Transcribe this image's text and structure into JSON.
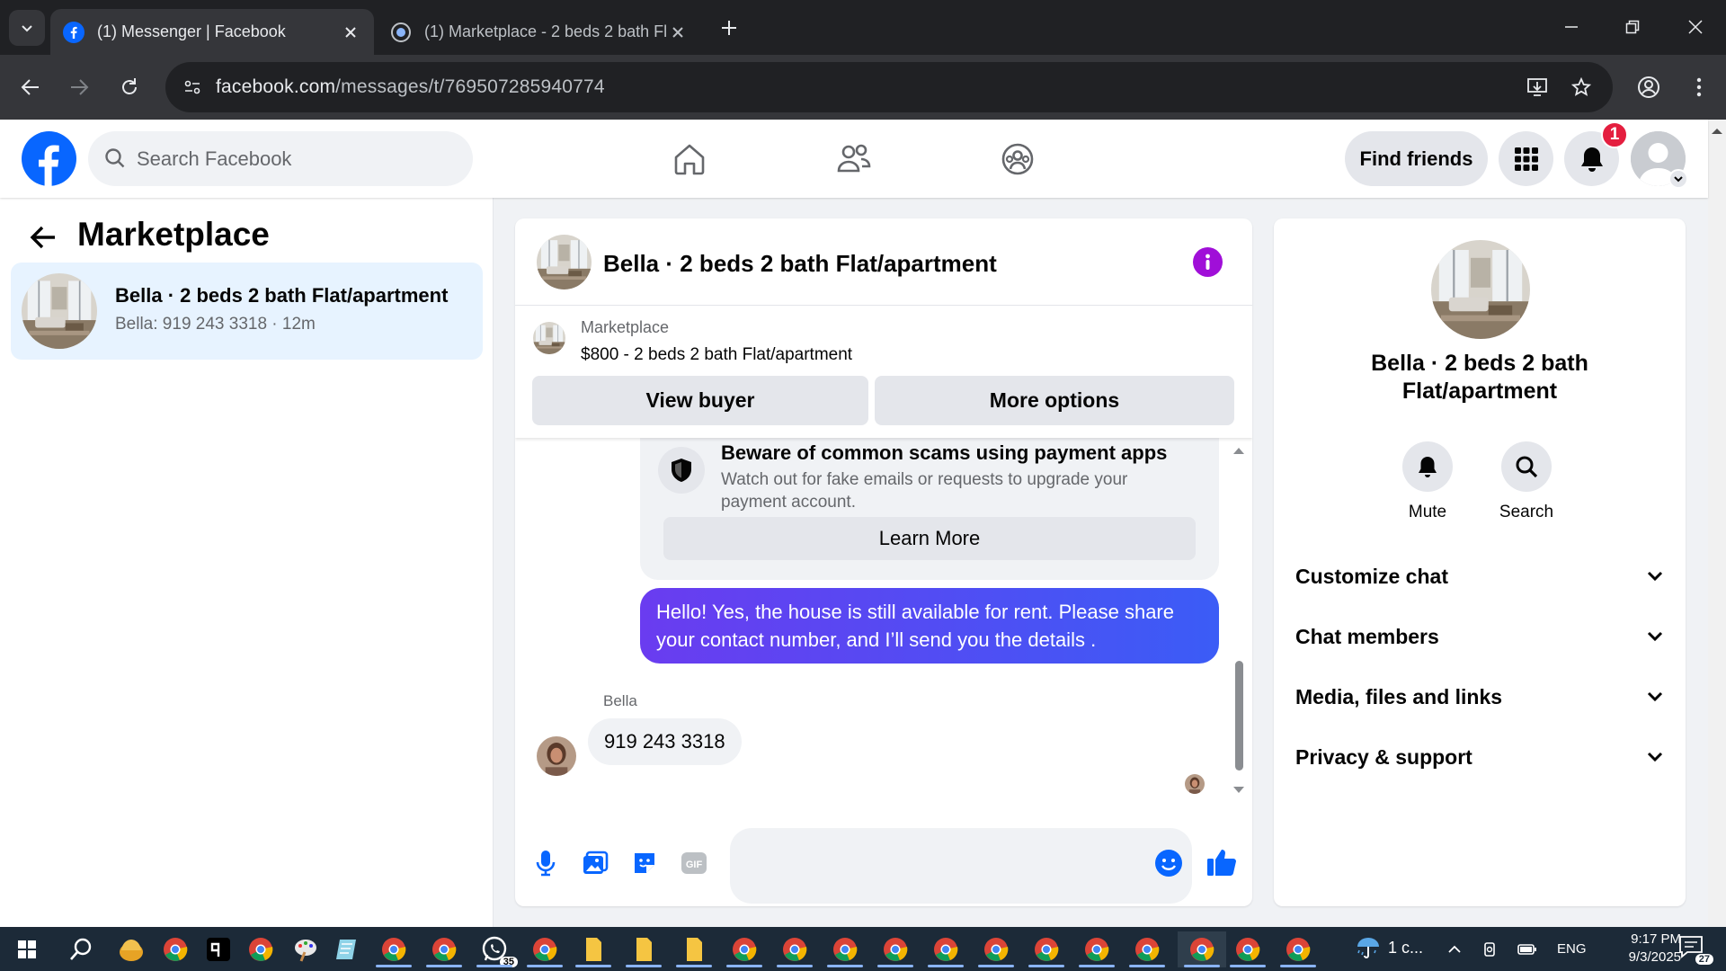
{
  "browser": {
    "tabs": [
      {
        "title": "(1) Messenger | Facebook"
      },
      {
        "title": "(1) Marketplace - 2 beds 2 bath Fla"
      }
    ],
    "url_domain": "facebook.com",
    "url_path": "/messages/t/769507285940774"
  },
  "facebook_header": {
    "search_placeholder": "Search Facebook",
    "find_friends_label": "Find friends",
    "notification_count": "1"
  },
  "left_panel": {
    "title": "Marketplace",
    "conversation": {
      "name": "Bella · 2 beds 2 bath Flat/apartment",
      "preview": "Bella: 919 243 3318 · 12m"
    }
  },
  "chat": {
    "title": "Bella · 2 beds 2 bath Flat/apartment",
    "listing": {
      "label": "Marketplace",
      "title": "$800 - 2 beds 2 bath Flat/apartment",
      "view_buyer_label": "View buyer",
      "more_options_label": "More options"
    },
    "scam_warning": {
      "title": "Beware of common scams using payment apps",
      "body": "Watch out for fake emails or requests to upgrade your payment account.",
      "button_label": "Learn More"
    },
    "messages": [
      {
        "direction": "outgoing",
        "text": "Hello! Yes, the house is still available for rent. Please share your contact number, and I’ll send you the details ."
      },
      {
        "direction": "incoming",
        "sender": "Bella",
        "text": "919 243 3318"
      }
    ],
    "composer_placeholder": ""
  },
  "info_panel": {
    "title": "Bella · 2 beds 2 bath Flat/apartment",
    "actions": [
      {
        "label": "Mute",
        "icon": "bell-icon"
      },
      {
        "label": "Search",
        "icon": "search-icon"
      }
    ],
    "sections": [
      {
        "label": "Customize chat"
      },
      {
        "label": "Chat members"
      },
      {
        "label": "Media, files and links"
      },
      {
        "label": "Privacy & support"
      }
    ]
  },
  "taskbar": {
    "weather": "1 c...",
    "language": "ENG",
    "time": "9:17 PM",
    "date": "9/3/2025",
    "notification_count": "27",
    "whatsapp_badge": "35"
  },
  "colors": {
    "fb_blue": "#0866ff",
    "chat_accent": "#4b44f4",
    "info_purple": "#a00fd8",
    "badge_red": "#e41e3f",
    "selected_conv_bg": "#e7f3ff"
  }
}
